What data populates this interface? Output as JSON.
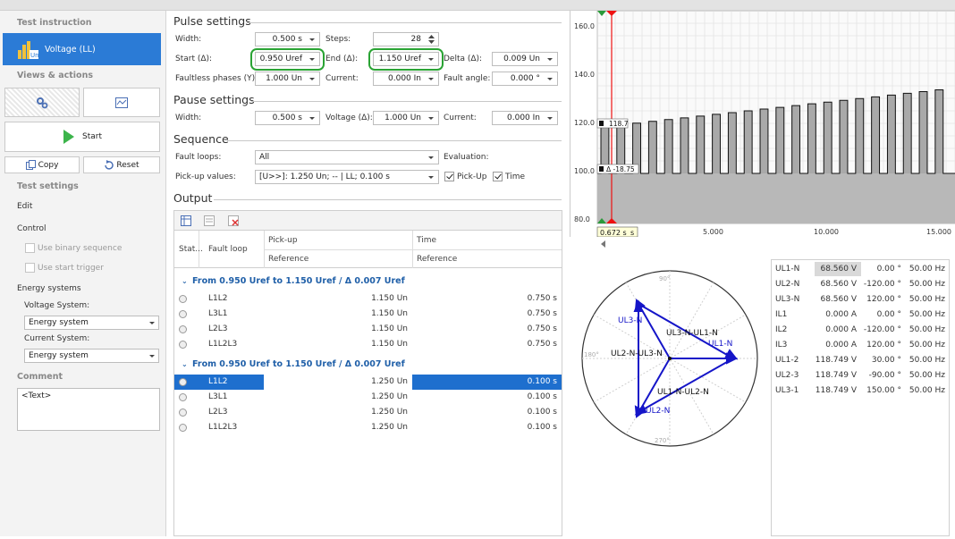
{
  "left": {
    "test_instruction": "Test instruction",
    "voltage_button": "Voltage (LL)",
    "views_actions": "Views & actions",
    "start": "Start",
    "copy": "Copy",
    "reset": "Reset",
    "test_settings": "Test settings",
    "edit": "Edit",
    "control": "Control",
    "use_binary": "Use binary sequence",
    "use_start_trigger": "Use start trigger",
    "energy_systems": "Energy systems",
    "voltage_system_label": "Voltage System:",
    "voltage_system_value": "Energy system",
    "current_system_label": "Current System:",
    "current_system_value": "Energy system",
    "comment": "Comment",
    "comment_text": "<Text>"
  },
  "pulse": {
    "title": "Pulse settings",
    "width_label": "Width:",
    "width_value": "0.500 s",
    "steps_label": "Steps:",
    "steps_value": "28",
    "start_label": "Start (Δ):",
    "start_value": "0.950 Uref",
    "end_label": "End (Δ):",
    "end_value": "1.150 Uref",
    "delta_label": "Delta (Δ):",
    "delta_value": "0.009 Un",
    "faultless_label": "Faultless phases (Y):",
    "faultless_value": "1.000 Un",
    "current_label": "Current:",
    "current_value": "0.000 In",
    "fault_angle_label": "Fault angle:",
    "fault_angle_value": "0.000 °"
  },
  "pause": {
    "title": "Pause settings",
    "width_label": "Width:",
    "width_value": "0.500 s",
    "voltage_label": "Voltage (Δ):",
    "voltage_value": "1.000 Un",
    "current_label": "Current:",
    "current_value": "0.000 In"
  },
  "sequence": {
    "title": "Sequence",
    "fault_loops_label": "Fault loops:",
    "fault_loops_value": "All",
    "evaluation_label": "Evaluation:",
    "pickup_label": "Pick-up values:",
    "pickup_value": "[U>>]: 1.250 Un; -- | LL; 0.100 s",
    "pickup_check": "Pick-Up",
    "time_check": "Time"
  },
  "output": {
    "title": "Output",
    "headers": {
      "status": "Stat...",
      "fault_loop": "Fault loop",
      "pickup": "Pick-up",
      "time": "Time",
      "reference1": "Reference",
      "reference2": "Reference"
    },
    "groups": [
      {
        "title": "From 0.950 Uref to 1.150 Uref / Δ 0.007 Uref",
        "rows": [
          {
            "loop": "L1L2",
            "pickup": "1.150 Un",
            "time": "0.750 s"
          },
          {
            "loop": "L3L1",
            "pickup": "1.150 Un",
            "time": "0.750 s"
          },
          {
            "loop": "L2L3",
            "pickup": "1.150 Un",
            "time": "0.750 s"
          },
          {
            "loop": "L1L2L3",
            "pickup": "1.150 Un",
            "time": "0.750 s"
          }
        ]
      },
      {
        "title": "From 0.950 Uref to 1.150 Uref / Δ 0.007 Uref",
        "rows": [
          {
            "loop": "L1L2",
            "pickup": "1.250 Un",
            "time": "0.100 s"
          },
          {
            "loop": "L3L1",
            "pickup": "1.250 Un",
            "time": "0.100 s"
          },
          {
            "loop": "L2L3",
            "pickup": "1.250 Un",
            "time": "0.100 s"
          },
          {
            "loop": "L1L2L3",
            "pickup": "1.250 Un",
            "time": "0.100 s"
          }
        ]
      }
    ]
  },
  "chart": {
    "y_ticks": [
      "160.0",
      "140.0",
      "120.0",
      "100.0",
      "80.0"
    ],
    "x_ticks": [
      "5.000",
      "10.000",
      "15.000"
    ],
    "cursor_a": "118.7",
    "cursor_delta": "Δ -18.75",
    "cursor_time": "0.672 s",
    "cursor_time_suffix": "s",
    "base_level": 100,
    "pulse_levels": [
      118.7,
      119.4,
      120.1,
      120.8,
      121.5,
      122.2,
      122.9,
      123.6,
      124.3,
      125.0,
      125.7,
      126.4,
      127.1,
      127.8,
      128.5,
      129.2,
      129.9,
      130.6,
      131.3,
      132.0,
      132.7,
      133.4
    ]
  },
  "polar": {
    "angle_labels": [
      "90°",
      "180°",
      "270°"
    ],
    "phasors": [
      "UL1-N",
      "UL2-N",
      "UL3-N"
    ],
    "lines": [
      "UL3-N-UL1-N",
      "UL2-N-UL3-N",
      "UL1-N-UL2-N"
    ]
  },
  "measurements": [
    {
      "name": "UL1-N",
      "mag": "68.560 V",
      "ang": "0.00 °",
      "freq": "50.00 Hz"
    },
    {
      "name": "UL2-N",
      "mag": "68.560 V",
      "ang": "-120.00 °",
      "freq": "50.00 Hz"
    },
    {
      "name": "UL3-N",
      "mag": "68.560 V",
      "ang": "120.00 °",
      "freq": "50.00 Hz"
    },
    {
      "name": "IL1",
      "mag": "0.000 A",
      "ang": "0.00 °",
      "freq": "50.00 Hz"
    },
    {
      "name": "IL2",
      "mag": "0.000 A",
      "ang": "-120.00 °",
      "freq": "50.00 Hz"
    },
    {
      "name": "IL3",
      "mag": "0.000 A",
      "ang": "120.00 °",
      "freq": "50.00 Hz"
    },
    {
      "name": "UL1-2",
      "mag": "118.749 V",
      "ang": "30.00 °",
      "freq": "50.00 Hz"
    },
    {
      "name": "UL2-3",
      "mag": "118.749 V",
      "ang": "-90.00 °",
      "freq": "50.00 Hz"
    },
    {
      "name": "UL3-1",
      "mag": "118.749 V",
      "ang": "150.00 °",
      "freq": "50.00 Hz"
    }
  ]
}
